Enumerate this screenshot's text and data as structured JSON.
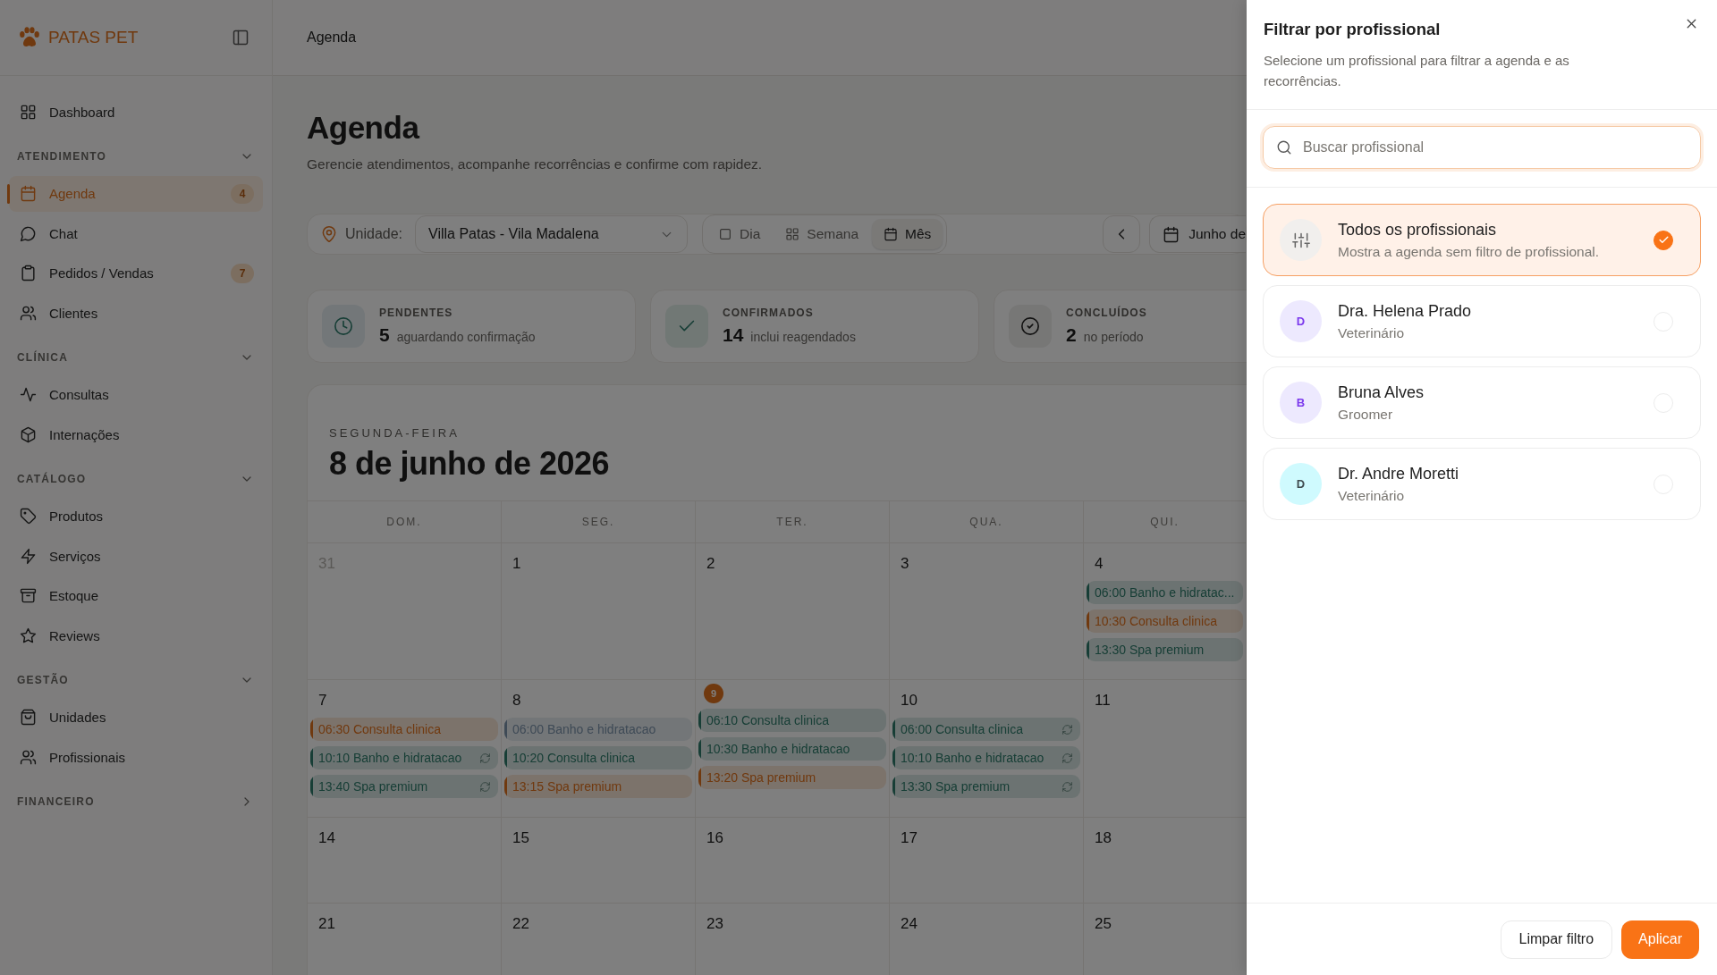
{
  "sidebar": {
    "brand": "PATAS PET",
    "sections": [
      {
        "items": [
          {
            "label": "Dashboard",
            "selected": false
          }
        ]
      },
      {
        "title": "ATENDIMENTO",
        "expanded": true,
        "items": [
          {
            "label": "Agenda",
            "selected": true,
            "badge": "4"
          },
          {
            "label": "Chat",
            "selected": false
          },
          {
            "label": "Pedidos / Vendas",
            "selected": false,
            "badge": "7"
          },
          {
            "label": "Clientes",
            "selected": false
          }
        ]
      },
      {
        "title": "CLÍNICA",
        "expanded": true,
        "items": [
          {
            "label": "Consultas",
            "selected": false
          },
          {
            "label": "Internações",
            "selected": false
          }
        ]
      },
      {
        "title": "CATÁLOGO",
        "expanded": true,
        "items": [
          {
            "label": "Produtos",
            "selected": false
          },
          {
            "label": "Serviços",
            "selected": false
          },
          {
            "label": "Estoque",
            "selected": false
          },
          {
            "label": "Reviews",
            "selected": false
          }
        ]
      },
      {
        "title": "GESTÃO",
        "expanded": true,
        "items": [
          {
            "label": "Unidades",
            "selected": false
          },
          {
            "label": "Profissionais",
            "selected": false
          }
        ]
      },
      {
        "title": "FINANCEIRO",
        "expanded": false
      }
    ]
  },
  "topbar": {
    "breadcrumb": "Agenda"
  },
  "page": {
    "title": "Agenda",
    "subtitle": "Gerencie atendimentos, acompanhe recorrências e confirme com rapidez."
  },
  "toolbar": {
    "unit_label": "Unidade:",
    "unit_value": "Villa Patas - Vila Madalena",
    "views": [
      {
        "label": "Dia",
        "selected": false
      },
      {
        "label": "Semana",
        "selected": false
      },
      {
        "label": "Mês",
        "selected": true
      }
    ],
    "date_button": "Junho de"
  },
  "stats": [
    {
      "kind": "pending",
      "label": "PENDENTES",
      "value": "5",
      "note": "aguardando confirmação"
    },
    {
      "kind": "confirmed",
      "label": "CONFIRMADOS",
      "value": "14",
      "note": "inclui reagendados"
    },
    {
      "kind": "done",
      "label": "CONCLUÍDOS",
      "value": "2",
      "note": "no período"
    }
  ],
  "calendar": {
    "weekday": "SEGUNDA-FEIRA",
    "date": "8 de junho de 2026",
    "weekdays": [
      "DOM.",
      "SEG.",
      "TER.",
      "QUA.",
      "QUI."
    ],
    "weeks": [
      [
        {
          "day": "31",
          "outside": true,
          "today": false
        },
        {
          "day": "1",
          "outside": false,
          "today": false
        },
        {
          "day": "2",
          "outside": false,
          "today": false
        },
        {
          "day": "3",
          "outside": false,
          "today": false
        },
        {
          "day": "4",
          "outside": false,
          "today": false,
          "events": [
            {
              "text": "06:00 Banho e hidratac...",
              "color": "#173e36",
              "recurring": false
            },
            {
              "text": "10:30 Consulta clinica",
              "color": "#70390f",
              "recurring": false
            },
            {
              "text": "13:30 Spa premium",
              "color": "#173e36",
              "recurring": false
            }
          ]
        }
      ],
      [
        {
          "day": "7",
          "outside": false,
          "today": false,
          "events": [
            {
              "text": "06:30 Consulta clinica",
              "color": "#70390f",
              "recurring": false
            },
            {
              "text": "10:10 Banho e hidratacao",
              "color": "#173e36",
              "recurring": true
            },
            {
              "text": "13:40 Spa premium",
              "color": "#173e36",
              "recurring": true
            }
          ]
        },
        {
          "day": "8",
          "outside": false,
          "today": false,
          "events": [
            {
              "text": "06:00 Banho e hidratacao",
              "color": "#3e4a56",
              "recurring": false
            },
            {
              "text": "10:20 Consulta clinica",
              "color": "#173e36",
              "recurring": false
            },
            {
              "text": "13:15 Spa premium",
              "color": "#70390f",
              "recurring": false
            }
          ]
        },
        {
          "day": "9",
          "outside": false,
          "today": true,
          "events": [
            {
              "text": "06:10 Consulta clinica",
              "color": "#173e36",
              "recurring": false
            },
            {
              "text": "10:30 Banho e hidratacao",
              "color": "#173e36",
              "recurring": false
            },
            {
              "text": "13:20 Spa premium",
              "color": "#70390f",
              "recurring": false
            }
          ]
        },
        {
          "day": "10",
          "outside": false,
          "today": false,
          "events": [
            {
              "text": "06:00 Consulta clinica",
              "color": "#173e36",
              "recurring": true
            },
            {
              "text": "10:10 Banho e hidratacao",
              "color": "#173e36",
              "recurring": true
            },
            {
              "text": "13:30 Spa premium",
              "color": "#173e36",
              "recurring": true
            }
          ]
        },
        {
          "day": "11",
          "outside": false,
          "today": false
        }
      ],
      [
        {
          "day": "14",
          "outside": false,
          "today": false
        },
        {
          "day": "15",
          "outside": false,
          "today": false
        },
        {
          "day": "16",
          "outside": false,
          "today": false
        },
        {
          "day": "17",
          "outside": false,
          "today": false
        },
        {
          "day": "18",
          "outside": false,
          "today": false
        }
      ],
      [
        {
          "day": "21",
          "outside": false,
          "today": false
        },
        {
          "day": "22",
          "outside": false,
          "today": false
        },
        {
          "day": "23",
          "outside": false,
          "today": false
        },
        {
          "day": "24",
          "outside": false,
          "today": false
        },
        {
          "day": "25",
          "outside": false,
          "today": false
        }
      ]
    ]
  },
  "drawer": {
    "title": "Filtrar por profissional",
    "description": "Selecione um profissional para filtrar a agenda e as recorrências.",
    "search": {
      "placeholder": "Buscar profissional"
    },
    "options": [
      {
        "kind": "all",
        "name": "Todos os profissionais",
        "detail": "Mostra a agenda sem filtro de profissional.",
        "selected": true
      },
      {
        "kind": "person",
        "initial": "D",
        "name": "Dra. Helena Prado",
        "detail": "Veterinário",
        "color": "#ede9fe",
        "selected": false
      },
      {
        "kind": "person",
        "initial": "B",
        "name": "Bruna Alves",
        "detail": "Groomer",
        "color": "#ede9fe",
        "selected": false
      },
      {
        "kind": "person",
        "initial": "D",
        "name": "Dr. Andre Moretti",
        "detail": "Veterinário",
        "color": "#cffafe",
        "selected": false
      }
    ],
    "buttons": [
      {
        "kind": "secondary",
        "label": "Limpar filtro"
      },
      {
        "kind": "primary",
        "label": "Aplicar"
      }
    ]
  }
}
